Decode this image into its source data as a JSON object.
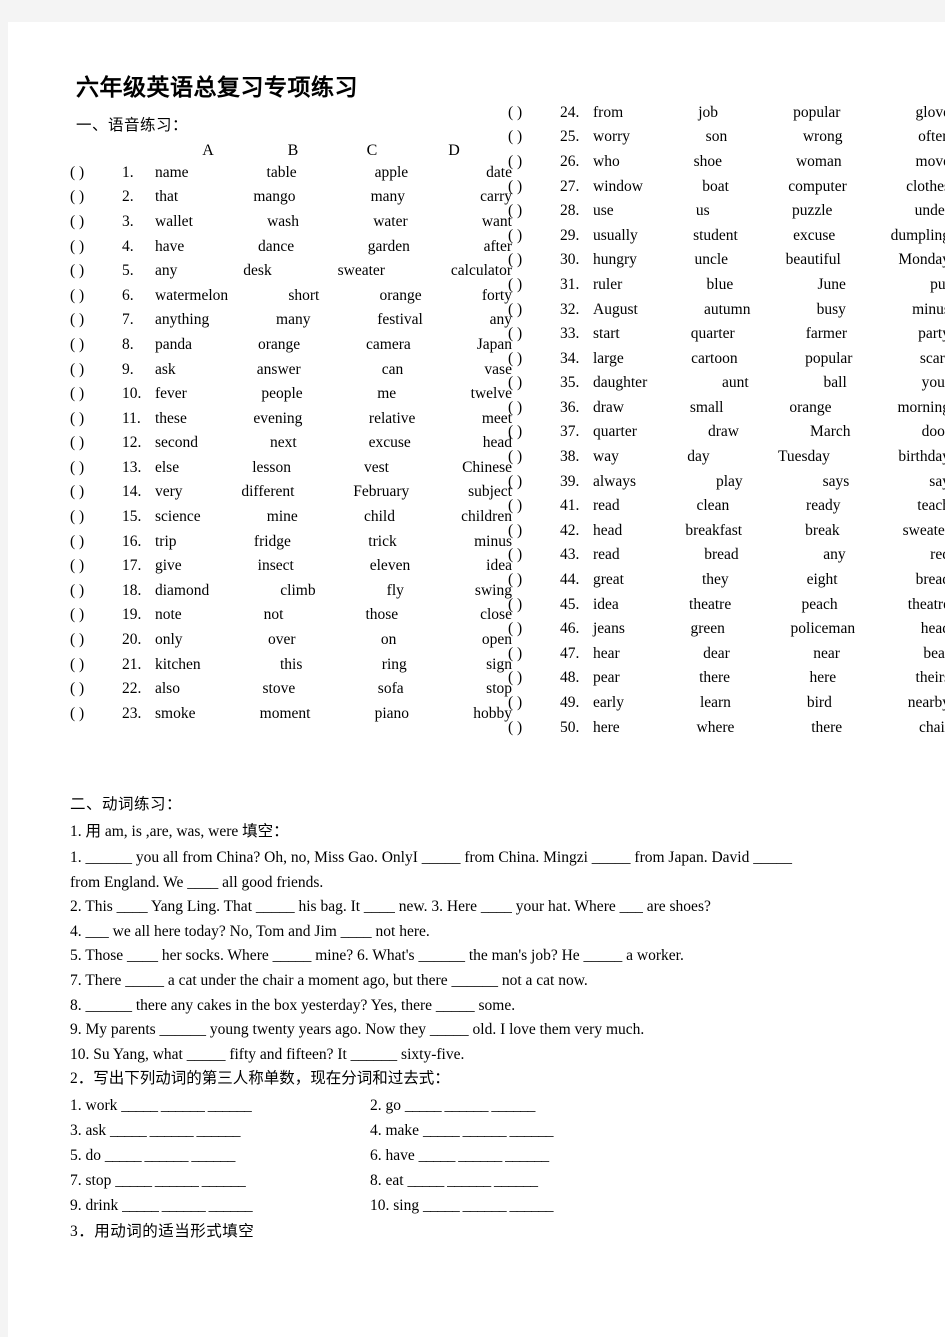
{
  "document": {
    "title": "六年级英语总复习专项练习"
  },
  "section1": {
    "heading": "一、语音练习：",
    "column_headers": [
      "A",
      "B",
      "C",
      "D"
    ],
    "paren": "(            )",
    "items_left": [
      {
        "num": "1.",
        "options": [
          "name",
          "table",
          "apple",
          "date"
        ]
      },
      {
        "num": "2.",
        "options": [
          "that",
          "mango",
          "many",
          "carry"
        ]
      },
      {
        "num": "3.",
        "options": [
          "wallet",
          "wash",
          "water",
          "want"
        ]
      },
      {
        "num": "4.",
        "options": [
          "have",
          "dance",
          "garden",
          "after"
        ]
      },
      {
        "num": "5.",
        "options": [
          "any",
          "desk",
          "sweater",
          "calculator"
        ]
      },
      {
        "num": "6.",
        "options": [
          "watermelon",
          "short",
          "orange",
          "forty"
        ]
      },
      {
        "num": "7.",
        "options": [
          "anything",
          "many",
          "festival",
          "any"
        ]
      },
      {
        "num": "8.",
        "options": [
          "panda",
          "orange",
          "camera",
          "Japan"
        ]
      },
      {
        "num": "9.",
        "options": [
          "ask",
          "answer",
          "can",
          "vase"
        ]
      },
      {
        "num": "10.",
        "options": [
          "fever",
          "people",
          "me",
          "twelve"
        ]
      },
      {
        "num": "11.",
        "options": [
          "these",
          "evening",
          "relative",
          "meet"
        ]
      },
      {
        "num": "12.",
        "options": [
          "second",
          "next",
          "excuse",
          "head"
        ]
      },
      {
        "num": "13.",
        "options": [
          "else",
          "lesson",
          "vest",
          "Chinese"
        ]
      },
      {
        "num": "14.",
        "options": [
          "very",
          "different",
          "February",
          "subject"
        ]
      },
      {
        "num": "15.",
        "options": [
          "science",
          "mine",
          "child",
          "children"
        ]
      },
      {
        "num": "16.",
        "options": [
          "trip",
          "fridge",
          "trick",
          "minus"
        ]
      },
      {
        "num": "17.",
        "options": [
          "give",
          "insect",
          "eleven",
          "idea"
        ]
      },
      {
        "num": "18.",
        "options": [
          "diamond",
          "climb",
          "fly",
          "swing"
        ]
      },
      {
        "num": "19.",
        "options": [
          "note",
          "not",
          "those",
          "close"
        ]
      },
      {
        "num": "20.",
        "options": [
          "only",
          "over",
          "on",
          "open"
        ]
      },
      {
        "num": "21.",
        "options": [
          "kitchen",
          "this",
          "ring",
          "sign"
        ]
      },
      {
        "num": "22.",
        "options": [
          "also",
          "stove",
          "sofa",
          "stop"
        ]
      },
      {
        "num": "23.",
        "options": [
          "smoke",
          "moment",
          "piano",
          "hobby"
        ]
      }
    ],
    "items_right": [
      {
        "num": "24.",
        "options": [
          "from",
          "job",
          "popular",
          "glove"
        ]
      },
      {
        "num": "25.",
        "options": [
          "worry",
          "son",
          "wrong",
          "often"
        ]
      },
      {
        "num": "26.",
        "options": [
          "who",
          "shoe",
          "woman",
          "move"
        ]
      },
      {
        "num": "27.",
        "options": [
          "window",
          "boat",
          "computer",
          "clothes"
        ]
      },
      {
        "num": "28.",
        "options": [
          "use",
          "us",
          "puzzle",
          "under"
        ]
      },
      {
        "num": "29.",
        "options": [
          "usually",
          "student",
          "excuse",
          "dumpling"
        ]
      },
      {
        "num": "30.",
        "options": [
          "hungry",
          "uncle",
          "beautiful",
          "Monday"
        ]
      },
      {
        "num": "31.",
        "options": [
          "ruler",
          "blue",
          "June",
          "put"
        ]
      },
      {
        "num": "32.",
        "options": [
          "August",
          "autumn",
          "busy",
          "minus"
        ]
      },
      {
        "num": "33.",
        "options": [
          "start",
          "quarter",
          "farmer",
          "party"
        ]
      },
      {
        "num": "34.",
        "options": [
          "large",
          "cartoon",
          "popular",
          "scarf"
        ]
      },
      {
        "num": "35.",
        "options": [
          "daughter",
          "aunt",
          "ball",
          "your"
        ]
      },
      {
        "num": "36.",
        "options": [
          "draw",
          "small",
          "orange",
          "morning"
        ]
      },
      {
        "num": "37.",
        "options": [
          "quarter",
          "draw",
          "March",
          "door"
        ]
      },
      {
        "num": "38.",
        "options": [
          "way",
          "day",
          "Tuesday",
          "birthday"
        ]
      },
      {
        "num": "39.",
        "options": [
          "always",
          "play",
          "says",
          "say"
        ]
      },
      {
        "num": "41.",
        "options": [
          "read",
          "clean",
          "ready",
          "teach"
        ]
      },
      {
        "num": "42.",
        "options": [
          "head",
          "breakfast",
          "break",
          "sweater"
        ]
      },
      {
        "num": "43.",
        "options": [
          "read",
          "bread",
          "any",
          "red"
        ]
      },
      {
        "num": "44.",
        "options": [
          "great",
          "they",
          "eight",
          "bread"
        ]
      },
      {
        "num": "45.",
        "options": [
          "idea",
          "theatre",
          "peach",
          "theatre"
        ]
      },
      {
        "num": "46.",
        "options": [
          "jeans",
          "green",
          "policeman",
          "head"
        ]
      },
      {
        "num": "47.",
        "options": [
          "hear",
          "dear",
          "near",
          "bear"
        ]
      },
      {
        "num": "48.",
        "options": [
          "pear",
          "there",
          "here",
          "theirs"
        ]
      },
      {
        "num": "49.",
        "options": [
          "early",
          "learn",
          "bird",
          "nearby"
        ]
      },
      {
        "num": "50.",
        "options": [
          "here",
          "where",
          "there",
          "chair"
        ]
      }
    ]
  },
  "section2": {
    "heading": "二、动词练习：",
    "ex1_heading": "1. 用 am, is ,are, was, were  填空：",
    "ex1_lines": [
      "1. ______ you all from China? Oh, no, Miss Gao. OnlyI _____     from China. Mingzi _____ from Japan. David _____",
      "from England. We ____ all good friends.",
      "2. This ____ Yang Ling. That _____ his bag. It ____ new. 3. Here ____ your hat. Where ___ are shoes?",
      "4. ___ we all here today? No, Tom and Jim ____ not here.",
      "5. Those ____ her socks. Where _____ mine? 6. What's ______ the man's job? He _____ a worker.",
      "7. There _____ a cat under the chair a moment ago, but there ______ not a cat now.",
      "8. ______ there any cakes in the box yesterday? Yes, there _____ some.",
      "9. My parents ______ young twenty years ago. Now they _____ old. I love them very much.",
      "10. Su Yang, what _____ fifty and fifteen? It ______ sixty-five."
    ],
    "ex2_heading": "2．写出下列动词的第三人称单数，现在分词和过去式：",
    "ex2_blank": "_____     ______     ______",
    "ex2_items": [
      {
        "num": "1.",
        "verb": "work"
      },
      {
        "num": "2.",
        "verb": "go"
      },
      {
        "num": "3.",
        "verb": "ask"
      },
      {
        "num": "4.",
        "verb": "make"
      },
      {
        "num": "5.",
        "verb": "do"
      },
      {
        "num": "6.",
        "verb": "have"
      },
      {
        "num": "7.",
        "verb": "stop"
      },
      {
        "num": "8.",
        "verb": "eat"
      },
      {
        "num": "9.",
        "verb": "drink"
      },
      {
        "num": "10.",
        "verb": "sing"
      }
    ],
    "ex3_heading": "3．用动词的适当形式填空"
  }
}
